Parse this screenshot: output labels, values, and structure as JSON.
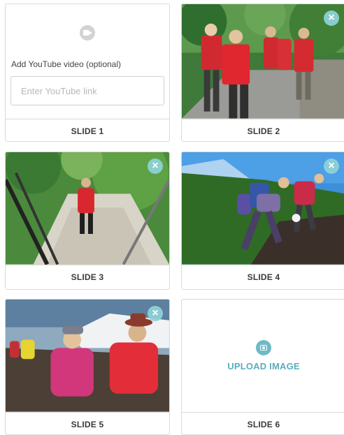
{
  "video_slot": {
    "label": "Add YouTube video (optional)",
    "placeholder": "Enter YouTube link",
    "value": ""
  },
  "slides": [
    {
      "label": "SLIDE 1"
    },
    {
      "label": "SLIDE 2"
    },
    {
      "label": "SLIDE 3"
    },
    {
      "label": "SLIDE 4"
    },
    {
      "label": "SLIDE 5"
    },
    {
      "label": "SLIDE 6"
    }
  ],
  "close_glyph": "×",
  "upload": {
    "label": "UPLOAD IMAGE"
  },
  "colors": {
    "accent": "#5aaebd",
    "close_bg": "#8dd1d6"
  }
}
